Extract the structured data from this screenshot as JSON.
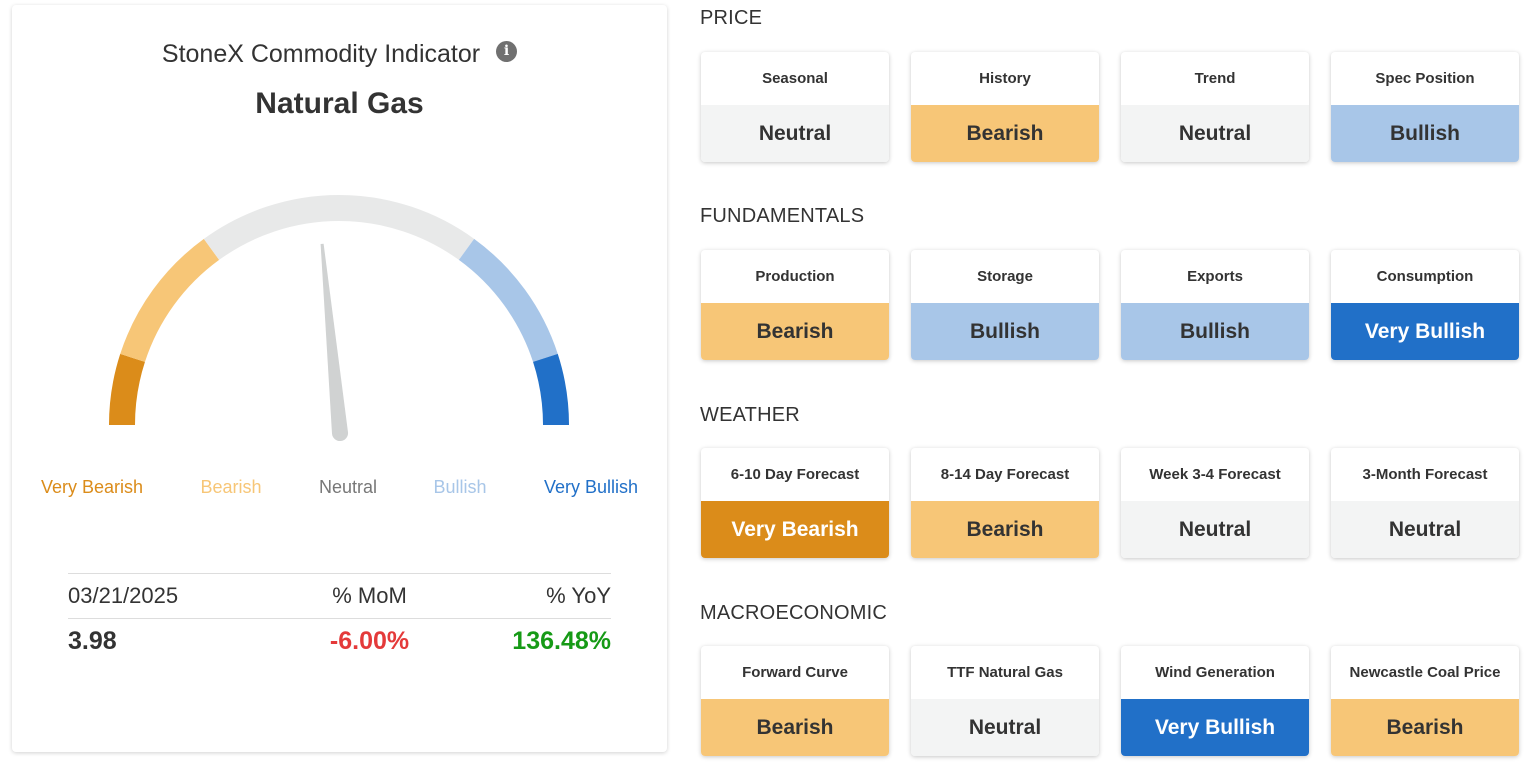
{
  "indicator": {
    "title": "StoneX Commodity Indicator",
    "info_icon": "info-icon",
    "commodity": "Natural Gas"
  },
  "colors": {
    "very_bearish": "#db8c1a",
    "bearish": "#f7c677",
    "neutral": "#f3f4f4",
    "neutral_arc": "#e8e9e9",
    "bullish": "#a8c6e8",
    "very_bullish": "#2170c8",
    "needle": "#d0d2d2",
    "negative": "#e43a3a",
    "positive": "#169a16",
    "neutral_text": "#777777"
  },
  "gauge": {
    "level": "Neutral",
    "needle_position": 0.47,
    "labels": [
      "Very Bearish",
      "Bearish",
      "Neutral",
      "Bullish",
      "Very Bullish"
    ]
  },
  "stats": {
    "date": "03/21/2025",
    "mom_header": "% MoM",
    "yoy_header": "% YoY",
    "price": "3.98",
    "mom_value": "-6.00%",
    "yoy_value": "136.48%"
  },
  "sections": [
    {
      "title": "PRICE",
      "tiles": [
        {
          "label": "Seasonal",
          "value": "Neutral"
        },
        {
          "label": "History",
          "value": "Bearish"
        },
        {
          "label": "Trend",
          "value": "Neutral"
        },
        {
          "label": "Spec Position",
          "value": "Bullish"
        }
      ]
    },
    {
      "title": "FUNDAMENTALS",
      "tiles": [
        {
          "label": "Production",
          "value": "Bearish"
        },
        {
          "label": "Storage",
          "value": "Bullish"
        },
        {
          "label": "Exports",
          "value": "Bullish"
        },
        {
          "label": "Consumption",
          "value": "Very Bullish"
        }
      ]
    },
    {
      "title": "WEATHER",
      "tiles": [
        {
          "label": "6-10 Day Forecast",
          "value": "Very Bearish"
        },
        {
          "label": "8-14 Day Forecast",
          "value": "Bearish"
        },
        {
          "label": "Week 3-4 Forecast",
          "value": "Neutral"
        },
        {
          "label": "3-Month Forecast",
          "value": "Neutral"
        }
      ]
    },
    {
      "title": "MACROECONOMIC",
      "tiles": [
        {
          "label": "Forward Curve",
          "value": "Bearish"
        },
        {
          "label": "TTF Natural Gas",
          "value": "Neutral"
        },
        {
          "label": "Wind Generation",
          "value": "Very Bullish"
        },
        {
          "label": "Newcastle Coal Price",
          "value": "Bearish"
        }
      ]
    }
  ]
}
